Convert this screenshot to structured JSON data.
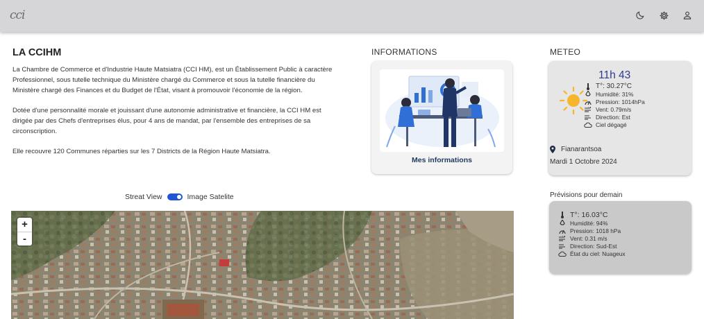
{
  "header": {
    "logo_text": "cci",
    "icons": [
      "moon-icon",
      "settings-icon",
      "user-icon"
    ]
  },
  "about": {
    "title": "LA CCIHM",
    "paragraphs": [
      "La Chambre de Commerce et d'Industrie Haute Matsiatra (CCI HM), est un Établissement Public à caractère Professionnel, sous tutelle technique du Ministère chargé du Commerce et sous la tutelle financière du Ministère chargé des Finances et du Budget de l'État, visant à promouvoir l'économie de la région.",
      "Dotée d'une personnalité morale et jouissant d'une autonomie administrative et financière, la CCI HM est dirigée par des Chefs d'entreprises élus, pour 4 ans de mandat, par l'ensemble des entreprises de sa circonscription.",
      "Elle recouvre 120 Communes réparties sur les 7 Districts de la Région Haute Matsiatra."
    ]
  },
  "informations": {
    "section_title": "INFORMATIONS",
    "card_label": "Mes informations"
  },
  "meteo": {
    "section_title": "METEO",
    "time": "11h 43",
    "temperature": "T°: 30.27°C",
    "humidity": "Humidité: 31%",
    "pressure": "Pression: 1014hPa",
    "wind": "Vent: 0.79m/s",
    "direction": "Direction: Est",
    "sky": "Ciel dégagé",
    "location": "Fianarantsoa",
    "date": "Mardi 1 Octobre 2024"
  },
  "forecast": {
    "section_title": "Prévisions pour demain",
    "temperature": "T°: 16.03°C",
    "humidity": "Humidité: 94%",
    "pressure": "Pression: 1018 hPa",
    "wind": "Vent: 0.31 m/s",
    "direction": "Direction: Sud-Est",
    "sky": "État du ciel: Nuageux"
  },
  "map": {
    "toggle_left": "Streat View",
    "toggle_right": "Image Satelite",
    "zoom_in": "+",
    "zoom_out": "-"
  },
  "colors": {
    "topbar": "#d6d6d9",
    "accent_blue": "#1e56d6",
    "time_color": "#2e3a8c",
    "sun": "#f7b52b"
  }
}
